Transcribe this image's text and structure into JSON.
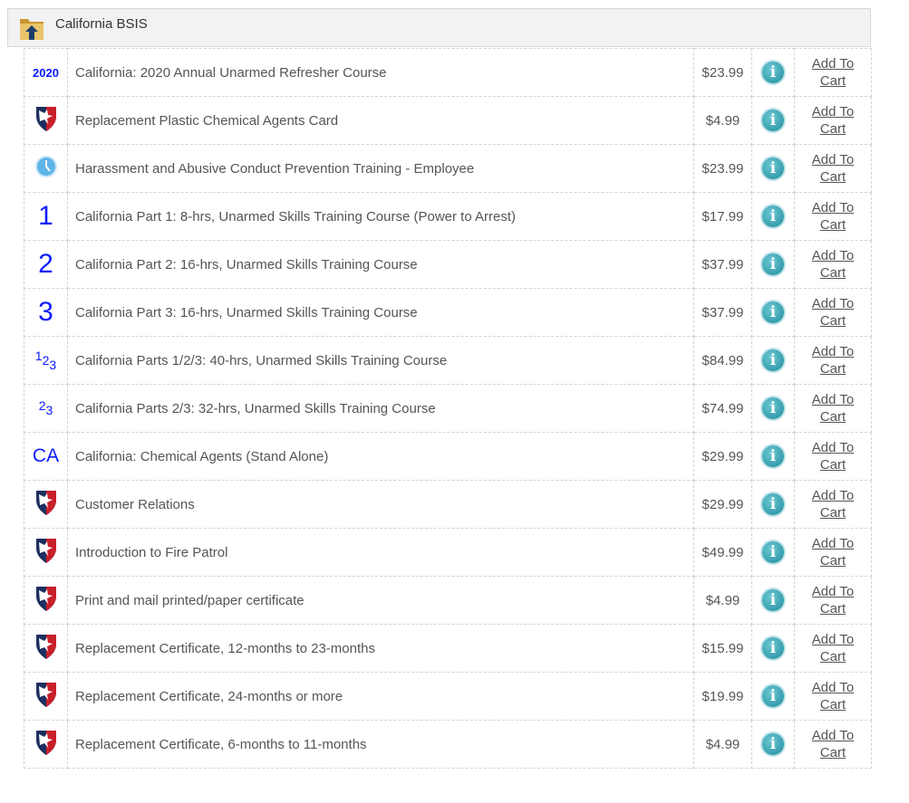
{
  "header": {
    "title": "California BSIS",
    "icon": "folder-upload-icon"
  },
  "colors": {
    "icon_text": "#0a1aff",
    "info": "#1f8c9c"
  },
  "cart_label_line1": "Add To",
  "cart_label_line2": "Cart",
  "rows": [
    {
      "icon": {
        "type": "text",
        "text": "2020",
        "style": "small"
      },
      "name": "California: 2020 Annual Unarmed Refresher Course",
      "price": "$23.99"
    },
    {
      "icon": {
        "type": "shield"
      },
      "name": "Replacement Plastic Chemical Agents Card",
      "price": "$4.99"
    },
    {
      "icon": {
        "type": "clock"
      },
      "name": "Harassment and Abusive Conduct Prevention Training - Employee",
      "price": "$23.99"
    },
    {
      "icon": {
        "type": "text",
        "text": "1",
        "style": "big"
      },
      "name": "California Part 1: 8-hrs, Unarmed Skills Training Course (Power to Arrest)",
      "price": "$17.99"
    },
    {
      "icon": {
        "type": "text",
        "text": "2",
        "style": "big"
      },
      "name": "California Part 2: 16-hrs, Unarmed Skills Training Course",
      "price": "$37.99"
    },
    {
      "icon": {
        "type": "text",
        "text": "3",
        "style": "big"
      },
      "name": "California Part 3: 16-hrs, Unarmed Skills Training Course",
      "price": "$37.99"
    },
    {
      "icon": {
        "type": "stagger",
        "parts": [
          "1",
          "2",
          "3"
        ]
      },
      "name": "California Parts 1/2/3: 40-hrs, Unarmed Skills Training Course",
      "price": "$84.99"
    },
    {
      "icon": {
        "type": "stagger",
        "parts": [
          "2",
          "3"
        ]
      },
      "name": "California Parts 2/3: 32-hrs, Unarmed Skills Training Course",
      "price": "$74.99"
    },
    {
      "icon": {
        "type": "text",
        "text": "CA",
        "style": "mid"
      },
      "name": "California: Chemical Agents (Stand Alone)",
      "price": "$29.99"
    },
    {
      "icon": {
        "type": "shield"
      },
      "name": "Customer Relations",
      "price": "$29.99"
    },
    {
      "icon": {
        "type": "shield"
      },
      "name": "Introduction to Fire Patrol",
      "price": "$49.99"
    },
    {
      "icon": {
        "type": "shield"
      },
      "name": "Print and mail printed/paper certificate",
      "price": "$4.99"
    },
    {
      "icon": {
        "type": "shield"
      },
      "name": "Replacement Certificate, 12-months to 23-months",
      "price": "$15.99"
    },
    {
      "icon": {
        "type": "shield"
      },
      "name": "Replacement Certificate, 24-months or more",
      "price": "$19.99"
    },
    {
      "icon": {
        "type": "shield"
      },
      "name": "Replacement Certificate, 6-months to 11-months",
      "price": "$4.99"
    }
  ]
}
